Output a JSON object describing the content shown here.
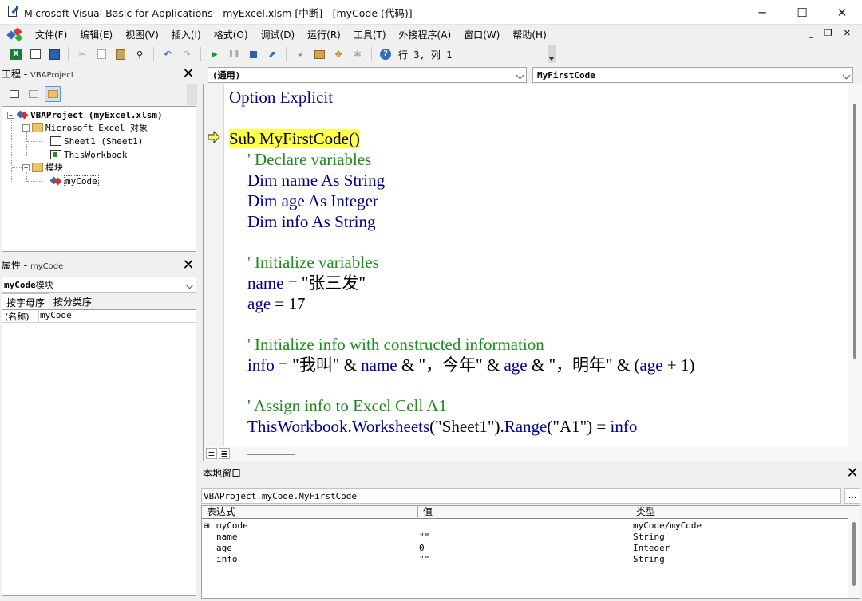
{
  "window": {
    "title": "Microsoft Visual Basic for Applications - myExcel.xlsm [中断] - [myCode (代码)]",
    "minimize": "─",
    "maximize": "☐",
    "close": "✕"
  },
  "menu": {
    "items": [
      "文件(F)",
      "编辑(E)",
      "视图(V)",
      "插入(I)",
      "格式(O)",
      "调试(D)",
      "运行(R)",
      "工具(T)",
      "外接程序(A)",
      "窗口(W)",
      "帮助(H)"
    ],
    "mdi_minimize": "_",
    "mdi_restore": "❐",
    "mdi_close": "✕"
  },
  "toolbar": {
    "status": "行 3, 列 1"
  },
  "project": {
    "title": "工程",
    "subtitle": "VBAProject",
    "close": "✕",
    "root": "VBAProject (myExcel.xlsm)",
    "objects_folder": "Microsoft Excel 对象",
    "sheet1": "Sheet1 (Sheet1)",
    "thisworkbook": "ThisWorkbook",
    "modules_folder": "模块",
    "module": "myCode",
    "expander_minus": "−"
  },
  "properties": {
    "title": "属性",
    "subtitle": "myCode",
    "close": "✕",
    "combo_name": "myCode",
    "combo_type": " 模块",
    "tab_alpha": "按字母序",
    "tab_category": "按分类序",
    "row_key": "(名称)",
    "row_value": "myCode"
  },
  "code": {
    "object_combo": "(通用)",
    "proc_combo": "MyFirstCode",
    "line_option": "Option Explicit",
    "line_sub": "Sub MyFirstCode()",
    "c_declare": "' Declare variables",
    "dim_name_kw": "Dim",
    "dim_name_var": " name ",
    "dim_name_as": "As String",
    "dim_age_kw": "Dim",
    "dim_age_var": " age ",
    "dim_age_as": "As Integer",
    "dim_info_kw": "Dim",
    "dim_info_var": " info ",
    "dim_info_as": "As String",
    "c_init": "' Initialize variables",
    "assign_name_var": "name",
    "assign_name_val": " = \"张三发\"",
    "assign_age_var": "age",
    "assign_age_val": " = 17",
    "c_info": "' Initialize info with constructed information",
    "info_line": {
      "p1": "info",
      "p2": " = \"我叫\" & ",
      "p3": "name",
      "p4": " & \"，今年\" & ",
      "p5": "age",
      "p6": " & \"，明年\" & (",
      "p7": "age",
      "p8": " + 1)"
    },
    "c_assign": "' Assign info to Excel Cell A1",
    "last_line": {
      "p1": "ThisWorkbook",
      "p2": ".",
      "p3": "Worksheets",
      "p4": "(\"Sheet1\").",
      "p5": "Range",
      "p6": "(\"A1\") = ",
      "p7": "info"
    },
    "view_proc": "≡",
    "view_full": "≣"
  },
  "locals": {
    "title": "本地窗口",
    "close": "✕",
    "context": "VBAProject.myCode.MyFirstCode",
    "dots": "...",
    "col_expr": "表达式",
    "col_value": "值",
    "col_type": "类型",
    "rows": [
      {
        "expander": "⊞",
        "expr": "myCode",
        "value": "",
        "type": "myCode/myCode"
      },
      {
        "expander": "",
        "expr": "name",
        "value": "\"\"",
        "type": "String"
      },
      {
        "expander": "",
        "expr": "age",
        "value": "0",
        "type": "Integer"
      },
      {
        "expander": "",
        "expr": "info",
        "value": "\"\"",
        "type": "String"
      }
    ]
  },
  "colors": {
    "keyword": "#00008b",
    "comment": "#1f8a1f",
    "highlight": "#ffff4d"
  }
}
